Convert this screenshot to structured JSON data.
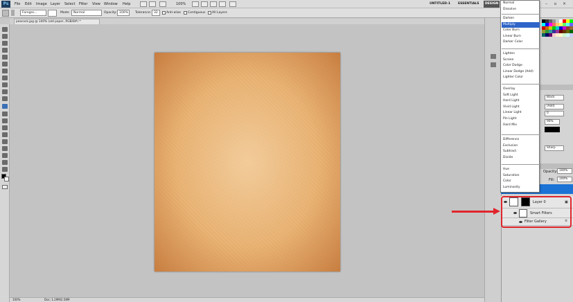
{
  "app": {
    "logo": "Ps"
  },
  "menu": [
    "File",
    "Edit",
    "Image",
    "Layer",
    "Select",
    "Filter",
    "View",
    "Window",
    "Help"
  ],
  "app_bar": {
    "zoom": "100%",
    "doc_name": "UNTITLED-1",
    "workspace_essentials": "ESSENTIALS",
    "workspace_design": "DESIGN"
  },
  "options_bar": {
    "fill_source": "Foregro...",
    "mode_label": "Mode:",
    "mode_value": "Normal",
    "opacity_label": "Opacity:",
    "opacity_value": "100%",
    "tolerance_label": "Tolerance:",
    "tolerance_value": "32",
    "anti_alias": "Anti-alias",
    "contiguous": "Contiguous",
    "all_layers": "All Layers"
  },
  "document_tab": "peacock.jpg @ 100% (old paper, RGB/8#) *",
  "statusbar": {
    "zoom": "100%",
    "doc_info": "Doc: 1.29M/2.58M"
  },
  "blend_modes": {
    "groups": [
      [
        "Normal",
        "Dissolve"
      ],
      [
        "Darken",
        "Multiply",
        "Color Burn",
        "Linear Burn",
        "Darker Color"
      ],
      [
        "Lighten",
        "Screen",
        "Color Dodge",
        "Linear Dodge (Add)",
        "Lighter Color"
      ],
      [
        "Overlay",
        "Soft Light",
        "Hard Light",
        "Vivid Light",
        "Linear Light",
        "Pin Light",
        "Hard Mix"
      ],
      [
        "Difference",
        "Exclusion",
        "Subtract",
        "Divide"
      ],
      [
        "Hue",
        "Saturation",
        "Color",
        "Luminosity"
      ]
    ],
    "selected": "Multiply"
  },
  "side_panel": {
    "fields": [
      "Black",
      "(Add)",
      "0",
      "90%",
      "Sharp"
    ],
    "opacity_label": "Opacity:",
    "opacity_value": "100%",
    "fill_label": "Fill:",
    "fill_value": "100%"
  },
  "layers": {
    "layer0": "Layer 0",
    "smart_filters": "Smart Filters",
    "filter_gallery": "Filter Gallery"
  },
  "colors": {
    "accent_red": "#e0242b",
    "selection_blue": "#2f64c8"
  }
}
